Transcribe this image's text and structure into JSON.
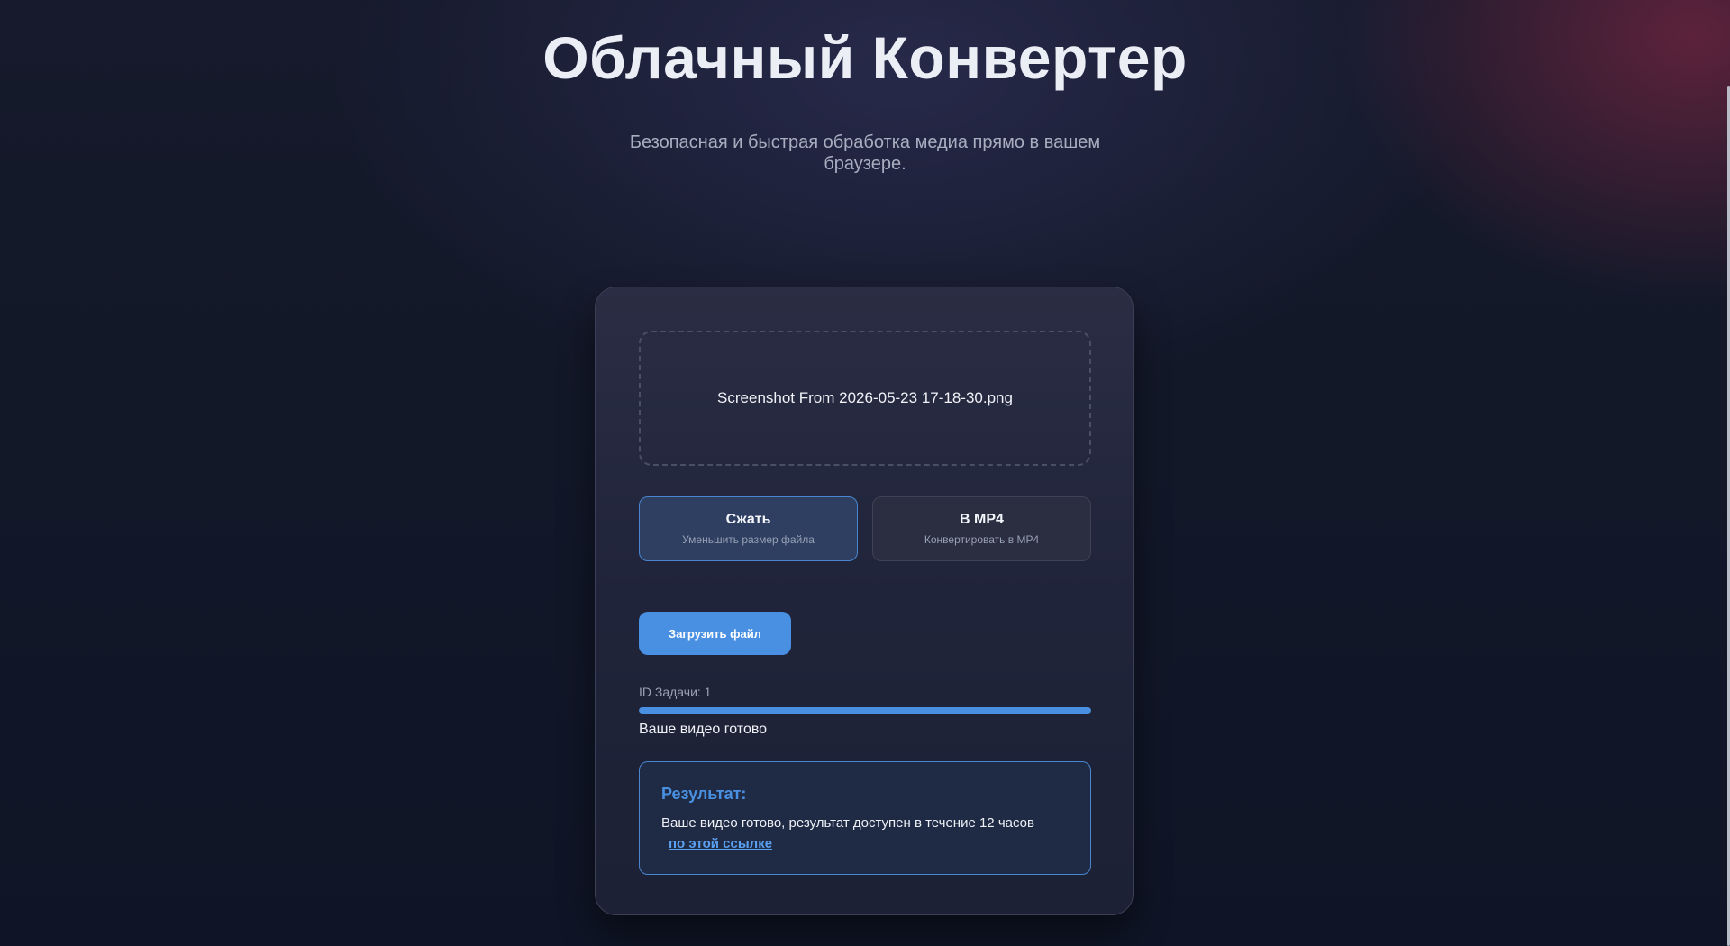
{
  "header": {
    "title": "Облачный Конвертер",
    "subtitle": "Безопасная и быстрая обработка медиа прямо в вашем браузере."
  },
  "dropzone": {
    "filename": "Screenshot From 2026-05-23 17-18-30.png"
  },
  "modes": [
    {
      "title": "Сжать",
      "subtitle": "Уменьшить размер файла",
      "selected": true
    },
    {
      "title": "В MP4",
      "subtitle": "Конвертировать в MP4",
      "selected": false
    }
  ],
  "upload_button": {
    "label": "Загрузить файл"
  },
  "task": {
    "id_label": "ID Задачи: 1",
    "progress_percent": 100,
    "status": "Ваше видео готово"
  },
  "result": {
    "heading": "Результат:",
    "text": "Ваше видео готово, результат доступен в течение 12 часов",
    "link_label": "по этой ссылке"
  },
  "colors": {
    "accent": "#4a90e2",
    "link": "#5aa0f0"
  }
}
